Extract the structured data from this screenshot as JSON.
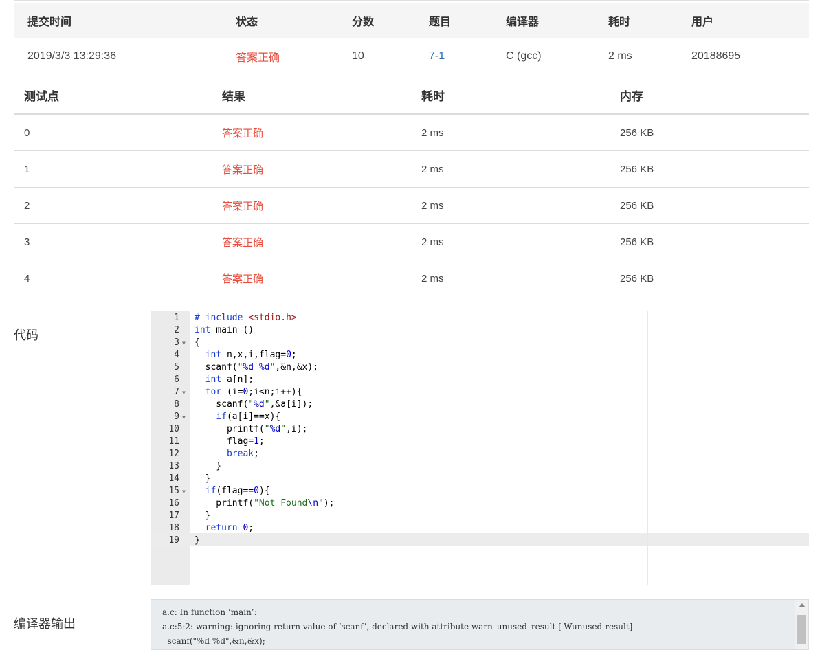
{
  "submission": {
    "headers": [
      "提交时间",
      "状态",
      "分数",
      "题目",
      "编译器",
      "耗时",
      "用户"
    ],
    "row": {
      "time": "2019/3/3 13:29:36",
      "status": "答案正确",
      "score": "10",
      "problem": "7-1",
      "compiler": "C (gcc)",
      "duration": "2 ms",
      "user": "20188695"
    }
  },
  "cases": {
    "headers": [
      "测试点",
      "结果",
      "耗时",
      "内存"
    ],
    "rows": [
      {
        "id": "0",
        "result": "答案正确",
        "time": "2 ms",
        "memory": "256 KB"
      },
      {
        "id": "1",
        "result": "答案正确",
        "time": "2 ms",
        "memory": "256 KB"
      },
      {
        "id": "2",
        "result": "答案正确",
        "time": "2 ms",
        "memory": "256 KB"
      },
      {
        "id": "3",
        "result": "答案正确",
        "time": "2 ms",
        "memory": "256 KB"
      },
      {
        "id": "4",
        "result": "答案正确",
        "time": "2 ms",
        "memory": "256 KB"
      }
    ]
  },
  "code": {
    "label": "代码",
    "lines": [
      {
        "n": "1",
        "text": "# include <stdio.h>"
      },
      {
        "n": "2",
        "text": "int main ()"
      },
      {
        "n": "3",
        "text": "{",
        "fold": true
      },
      {
        "n": "4",
        "text": "  int n,x,i,flag=0;"
      },
      {
        "n": "5",
        "text": "  scanf(\"%d %d\",&n,&x);"
      },
      {
        "n": "6",
        "text": "  int a[n];"
      },
      {
        "n": "7",
        "text": "  for (i=0;i<n;i++){",
        "fold": true
      },
      {
        "n": "8",
        "text": "    scanf(\"%d\",&a[i]);"
      },
      {
        "n": "9",
        "text": "    if(a[i]==x){",
        "fold": true
      },
      {
        "n": "10",
        "text": "      printf(\"%d\",i);"
      },
      {
        "n": "11",
        "text": "      flag=1;"
      },
      {
        "n": "12",
        "text": "      break;"
      },
      {
        "n": "13",
        "text": "    }"
      },
      {
        "n": "14",
        "text": "  }"
      },
      {
        "n": "15",
        "text": "  if(flag==0){",
        "fold": true
      },
      {
        "n": "16",
        "text": "    printf(\"Not Found\\n\");"
      },
      {
        "n": "17",
        "text": "  }"
      },
      {
        "n": "18",
        "text": "  return 0;"
      },
      {
        "n": "19",
        "text": "}"
      }
    ]
  },
  "compiler_output": {
    "label": "编译器输出",
    "lines": [
      "a.c: In function ‘main’:",
      "a.c:5:2: warning: ignoring return value of ‘scanf’, declared with attribute warn_unused_result [-Wunused-result]",
      "  scanf(\"%d %d\",&n,&x);"
    ]
  },
  "colors": {
    "accepted": "#e74c3c",
    "link": "#2a6db3",
    "keyword": "#1a3dd6",
    "string": "#1a6b1a"
  }
}
